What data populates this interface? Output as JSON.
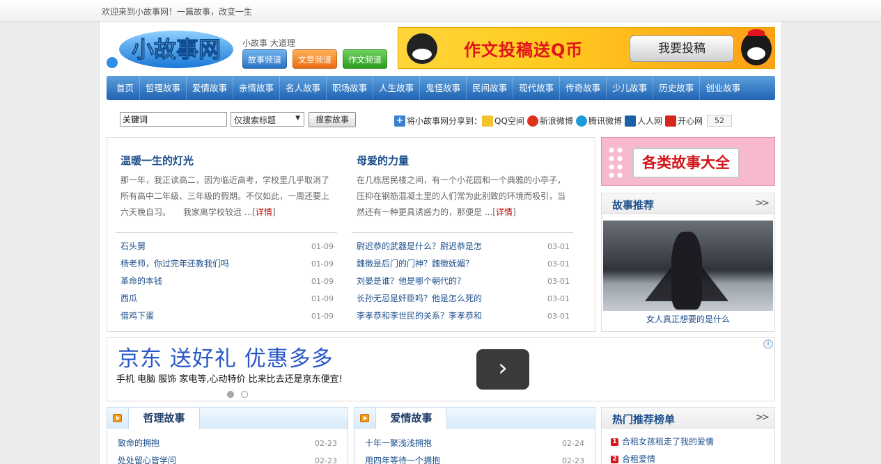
{
  "topbar": {
    "welcome": "欢迎来到小故事网！一篇故事，改变一生"
  },
  "header": {
    "logo_text": "小故事网",
    "slogan": "小故事 大道理",
    "channels": [
      "故事频道",
      "文章频道",
      "作文频道"
    ],
    "banner": {
      "text": "作文投稿送Q币",
      "button": "我要投稿"
    }
  },
  "nav": [
    "首页",
    "哲理故事",
    "爱情故事",
    "亲情故事",
    "名人故事",
    "职场故事",
    "人生故事",
    "鬼怪故事",
    "民间故事",
    "现代故事",
    "传奇故事",
    "少儿故事",
    "历史故事",
    "创业故事"
  ],
  "search": {
    "value": "关键词",
    "select": "仅搜索标题",
    "button": "搜索故事"
  },
  "share": {
    "label": "将小故事网分享到：",
    "targets": [
      "QQ空间",
      "新浪微博",
      "腾讯微博",
      "人人网",
      "开心网"
    ],
    "count": "52"
  },
  "featured": [
    {
      "title": "温暖一生的灯光",
      "excerpt": "那一年，我正读高二，因为临近高考，学校里几乎取消了所有高中二年级、三年级的假期。不仅如此，一周还要上六天晚自习。　　我家离学校较远 ...",
      "more": "详情",
      "list": [
        {
          "title": "石头舅",
          "date": "01-09"
        },
        {
          "title": "杨老师，你过完年还教我们吗",
          "date": "01-09"
        },
        {
          "title": "革命的本钱",
          "date": "01-09"
        },
        {
          "title": "西瓜",
          "date": "01-09"
        },
        {
          "title": "借鸡下蛋",
          "date": "01-09"
        }
      ]
    },
    {
      "title": "母爱的力量",
      "excerpt": "在几栋居民楼之间，有一个小花园和一个典雅的小亭子，压抑在钢筋混凝土里的人们常为此别致的环境而吸引，当然还有一种更具诱惑力的，那便是 ...",
      "more": "详情",
      "list": [
        {
          "title": "尉迟恭的武器是什么？尉迟恭是怎",
          "date": "03-01"
        },
        {
          "title": "魏徵是后门的门神？魏徵妩媚？",
          "date": "03-01"
        },
        {
          "title": "刘晏是谁？他是哪个朝代的？",
          "date": "03-01"
        },
        {
          "title": "长孙无忌是奸臣吗？他是怎么死的",
          "date": "03-01"
        },
        {
          "title": "李孝恭和李世民的关系？李孝恭和",
          "date": "03-01"
        }
      ]
    }
  ],
  "side": {
    "banner_text": "各类故事大全",
    "recommend_title": "故事推荐",
    "recommend_caption": "女人真正想要的是什么",
    "hot_title": "热门推荐榜单",
    "hot_list": [
      "合租女孩租走了我的爱情",
      "合租爱情"
    ]
  },
  "ad": {
    "headline": "京东 送好礼 优惠多多",
    "subline": "手机 电脑 服饰 家电等,心动特价 比来比去还是京东便宜!"
  },
  "panels": [
    {
      "tab": "哲理故事",
      "list": [
        {
          "title": "致命的拥抱",
          "date": "02-23"
        },
        {
          "title": "处处留心皆学问",
          "date": "02-23"
        }
      ]
    },
    {
      "tab": "爱情故事",
      "list": [
        {
          "title": "十年一聚浅浅拥抱",
          "date": "02-24"
        },
        {
          "title": "用四年等待一个拥抱",
          "date": "02-23"
        }
      ]
    }
  ],
  "colors": {
    "nav_blue": "#1f63b2",
    "link_blue": "#1d4f8c",
    "more_red": "#b40000"
  }
}
